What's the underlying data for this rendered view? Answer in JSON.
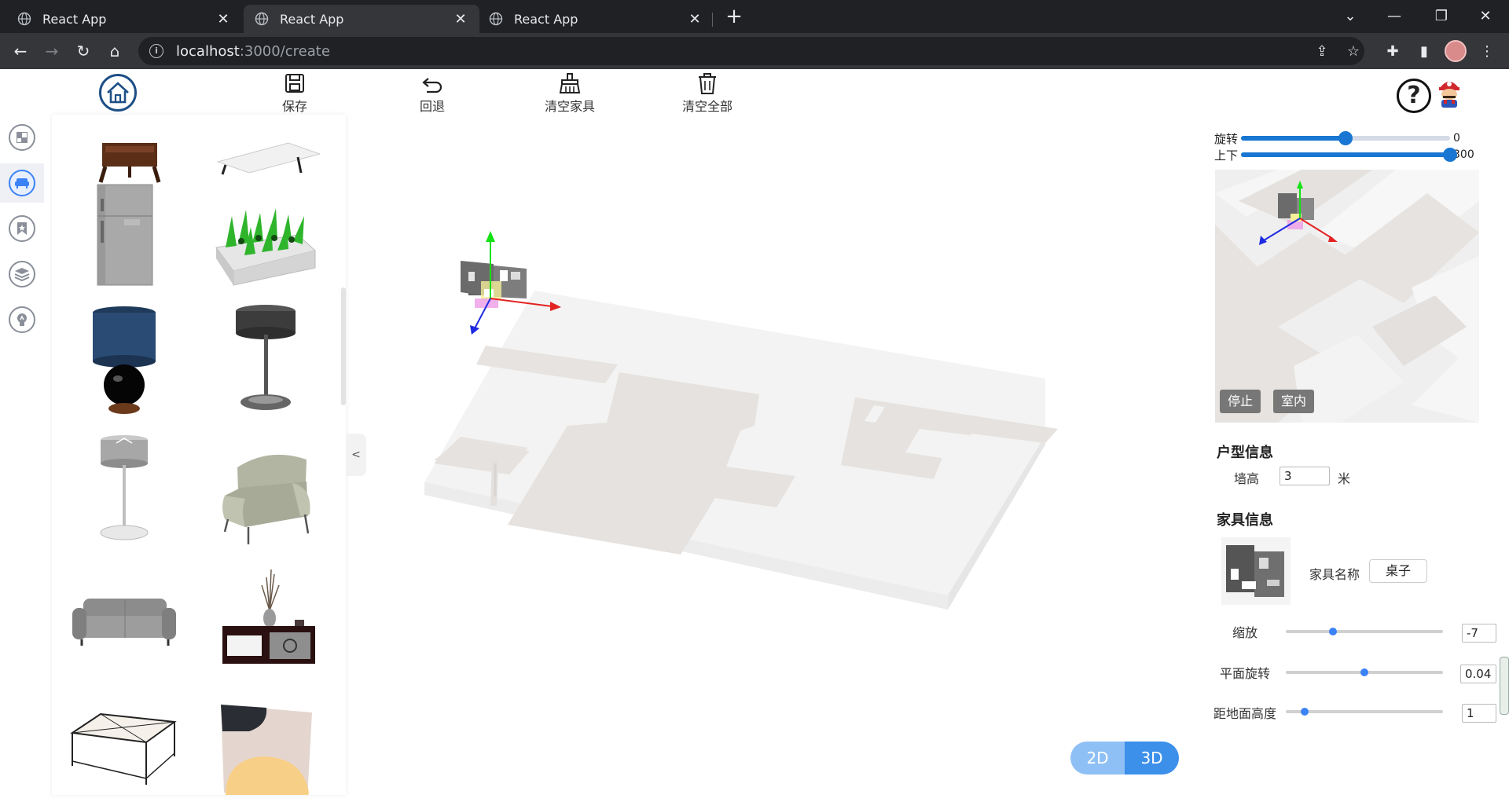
{
  "browser": {
    "tabs": [
      {
        "title": "React App",
        "active": false
      },
      {
        "title": "React App",
        "active": true
      },
      {
        "title": "React App",
        "active": false
      }
    ],
    "url_host": "localhost",
    "url_path": ":3000/create"
  },
  "header": {
    "tools": [
      {
        "label": "保存",
        "icon": "save-icon"
      },
      {
        "label": "回退",
        "icon": "undo-icon"
      },
      {
        "label": "清空家具",
        "icon": "broom-icon"
      },
      {
        "label": "清空全部",
        "icon": "trash-icon"
      }
    ],
    "help_label": "?"
  },
  "rail": {
    "items": [
      {
        "icon": "floorplan-icon",
        "active": false
      },
      {
        "icon": "sofa-icon",
        "active": true
      },
      {
        "icon": "bookmark-icon",
        "active": false
      },
      {
        "icon": "layers-icon",
        "active": false
      },
      {
        "icon": "lightbulb-icon",
        "active": false
      }
    ]
  },
  "panel": {
    "collapse_label": "<",
    "items": [
      "nightstand",
      "table",
      "fridge",
      "planter",
      "table-lamp-blue",
      "floor-lamp-dark",
      "floor-lamp-grey",
      "armchair",
      "sofa",
      "tv-cabinet",
      "coffee-table",
      "rug"
    ]
  },
  "view": {
    "mode_2d": "2D",
    "mode_3d": "3D",
    "active_mode": "3D"
  },
  "camera": {
    "rotate_label": "旋转",
    "rotate_value": "0",
    "rotate_fraction": 0.5,
    "updown_label": "上下",
    "updown_value": "300",
    "updown_fraction": 1.0
  },
  "minimap": {
    "stop_label": "停止",
    "indoor_label": "室内"
  },
  "house_info": {
    "title": "户型信息",
    "wall_height_label": "墙高",
    "wall_height_value": "3",
    "wall_height_unit": "米"
  },
  "furniture_info": {
    "title": "家具信息",
    "name_label": "家具名称",
    "name_value": "桌子",
    "scale_label": "缩放",
    "scale_value": "-7",
    "scale_fraction": 0.3,
    "rotation_label": "平面旋转",
    "rotation_value": "0.04",
    "rotation_fraction": 0.5,
    "height_label": "距地面高度",
    "height_value": "1",
    "height_fraction": 0.12
  },
  "colors": {
    "accent": "#1976d2",
    "mode_2d": "#8fc0f5",
    "mode_3d": "#3c90ea",
    "logo": "#1d4f86"
  }
}
